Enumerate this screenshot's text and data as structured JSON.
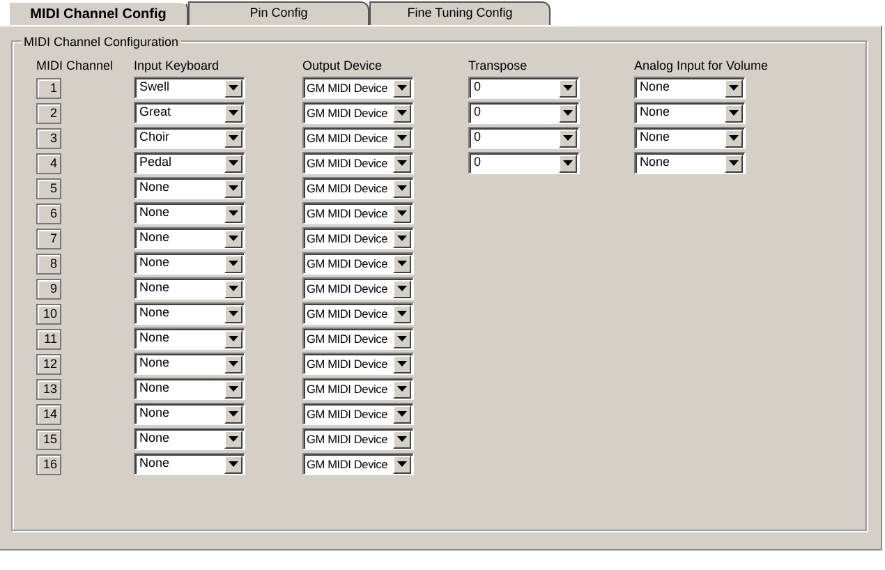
{
  "tabs": [
    {
      "label": "MIDI Channel Config",
      "selected": true
    },
    {
      "label": "Pin Config",
      "selected": false
    },
    {
      "label": "Fine Tuning Config",
      "selected": false
    }
  ],
  "group": {
    "title": "MIDI Channel Configuration"
  },
  "columns": [
    "MIDI Channel",
    "Input Keyboard",
    "Output Device",
    "Transpose",
    "Analog Input for Volume"
  ],
  "rows": [
    {
      "channel": "1",
      "input": "Swell",
      "output": "GM MIDI Device",
      "transpose": "0",
      "analog": "None"
    },
    {
      "channel": "2",
      "input": "Great",
      "output": "GM MIDI Device",
      "transpose": "0",
      "analog": "None"
    },
    {
      "channel": "3",
      "input": "Choir",
      "output": "GM MIDI Device",
      "transpose": "0",
      "analog": "None"
    },
    {
      "channel": "4",
      "input": "Pedal",
      "output": "GM MIDI Device",
      "transpose": "0",
      "analog": "None"
    },
    {
      "channel": "5",
      "input": "None",
      "output": "GM MIDI Device"
    },
    {
      "channel": "6",
      "input": "None",
      "output": "GM MIDI Device"
    },
    {
      "channel": "7",
      "input": "None",
      "output": "GM MIDI Device"
    },
    {
      "channel": "8",
      "input": "None",
      "output": "GM MIDI Device"
    },
    {
      "channel": "9",
      "input": "None",
      "output": "GM MIDI Device"
    },
    {
      "channel": "10",
      "input": "None",
      "output": "GM MIDI Device"
    },
    {
      "channel": "11",
      "input": "None",
      "output": "GM MIDI Device"
    },
    {
      "channel": "12",
      "input": "None",
      "output": "GM MIDI Device"
    },
    {
      "channel": "13",
      "input": "None",
      "output": "GM MIDI Device"
    },
    {
      "channel": "14",
      "input": "None",
      "output": "GM MIDI Device"
    },
    {
      "channel": "15",
      "input": "None",
      "output": "GM MIDI Device"
    },
    {
      "channel": "16",
      "input": "None",
      "output": "GM MIDI Device"
    }
  ]
}
